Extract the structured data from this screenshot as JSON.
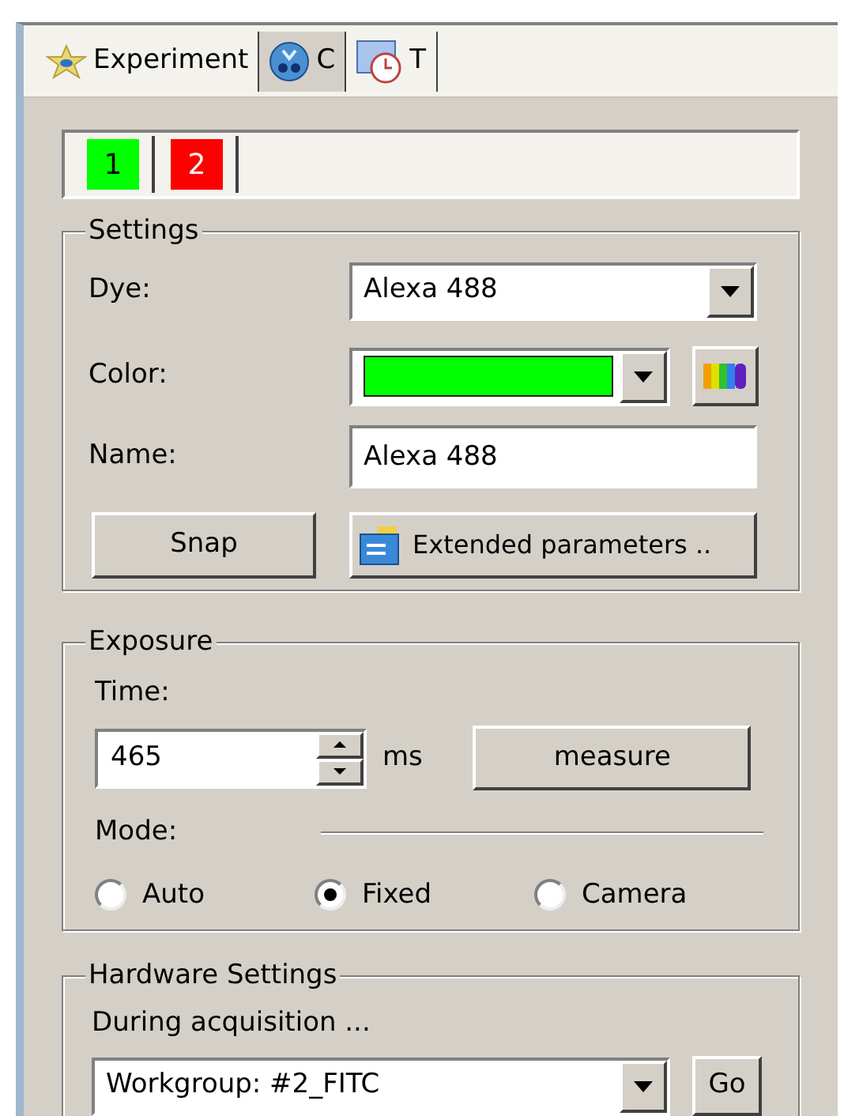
{
  "tabs": [
    {
      "label": "Experiment",
      "selected": false,
      "kind": "experiment"
    },
    {
      "label": "C",
      "selected": true,
      "kind": "channel"
    },
    {
      "label": "T",
      "selected": false,
      "kind": "time"
    }
  ],
  "channels": [
    {
      "label": "1",
      "color": "#00ff00"
    },
    {
      "label": "2",
      "color": "#ff0000"
    }
  ],
  "settings": {
    "title": "Settings",
    "dye_label": "Dye:",
    "dye_value": "Alexa 488",
    "color_label": "Color:",
    "color": "#00ff00",
    "name_label": "Name:",
    "name_value": "Alexa 488",
    "snap": "Snap",
    "extended": "Extended parameters .."
  },
  "exposure": {
    "title": "Exposure",
    "time_label": "Time:",
    "time_value": "465",
    "unit": "ms",
    "measure": "measure",
    "mode_label": "Mode:",
    "modes": [
      {
        "label": "Auto",
        "selected": false
      },
      {
        "label": "Fixed",
        "selected": true
      },
      {
        "label": "Camera",
        "selected": false
      }
    ]
  },
  "hardware": {
    "title": "Hardware Settings",
    "hint": "During acquisition ...",
    "workgroup": "Workgroup: #2_FITC",
    "go": "Go"
  }
}
